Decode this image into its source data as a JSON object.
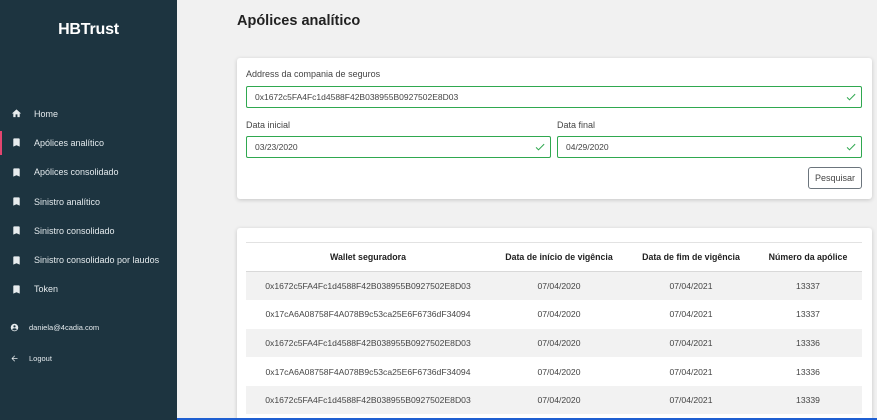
{
  "sidebar": {
    "logo": "HBTrust",
    "items": [
      {
        "label": "Home",
        "icon": "home-icon"
      },
      {
        "label": "Apólices analítico",
        "icon": "bookmark-icon"
      },
      {
        "label": "Apólices consolidado",
        "icon": "bookmark-icon"
      },
      {
        "label": "Sinistro analítico",
        "icon": "bookmark-icon"
      },
      {
        "label": "Sinistro consolidado",
        "icon": "bookmark-icon"
      },
      {
        "label": "Sinistro consolidado por laudos",
        "icon": "bookmark-icon"
      },
      {
        "label": "Token",
        "icon": "bookmark-icon"
      }
    ],
    "active_index": 1,
    "user_email": "daniela@4cadia.com",
    "logout_label": "Logout"
  },
  "main": {
    "title": "Apólices analítico"
  },
  "form": {
    "address_label": "Address da compania de seguros",
    "address_value": "0x1672c5FA4Fc1d4588F42B038955B0927502E8D03",
    "start_label": "Data inicial",
    "start_value": "03/23/2020",
    "end_label": "Data final",
    "end_value": "04/29/2020",
    "search_label": "Pesquisar"
  },
  "table": {
    "headers": [
      "Wallet seguradora",
      "Data de início de vigência",
      "Data de fim de vigência",
      "Número da apólice"
    ],
    "rows": [
      [
        "0x1672c5FA4Fc1d4588F42B038955B0927502E8D03",
        "07/04/2020",
        "07/04/2021",
        "13337"
      ],
      [
        "0x17cA6A08758F4A078B9c53ca25E6F6736dF34094",
        "07/04/2020",
        "07/04/2021",
        "13337"
      ],
      [
        "0x1672c5FA4Fc1d4588F42B038955B0927502E8D03",
        "07/04/2020",
        "07/04/2021",
        "13336"
      ],
      [
        "0x17cA6A08758F4A078B9c53ca25E6F6736dF34094",
        "07/04/2020",
        "07/04/2021",
        "13336"
      ],
      [
        "0x1672c5FA4Fc1d4588F42B038955B0927502E8D03",
        "07/04/2020",
        "07/04/2021",
        "13339"
      ]
    ]
  },
  "colors": {
    "sidebar_bg": "#1d3440",
    "active_accent": "#e2456f",
    "valid_green": "#2fa84f"
  }
}
